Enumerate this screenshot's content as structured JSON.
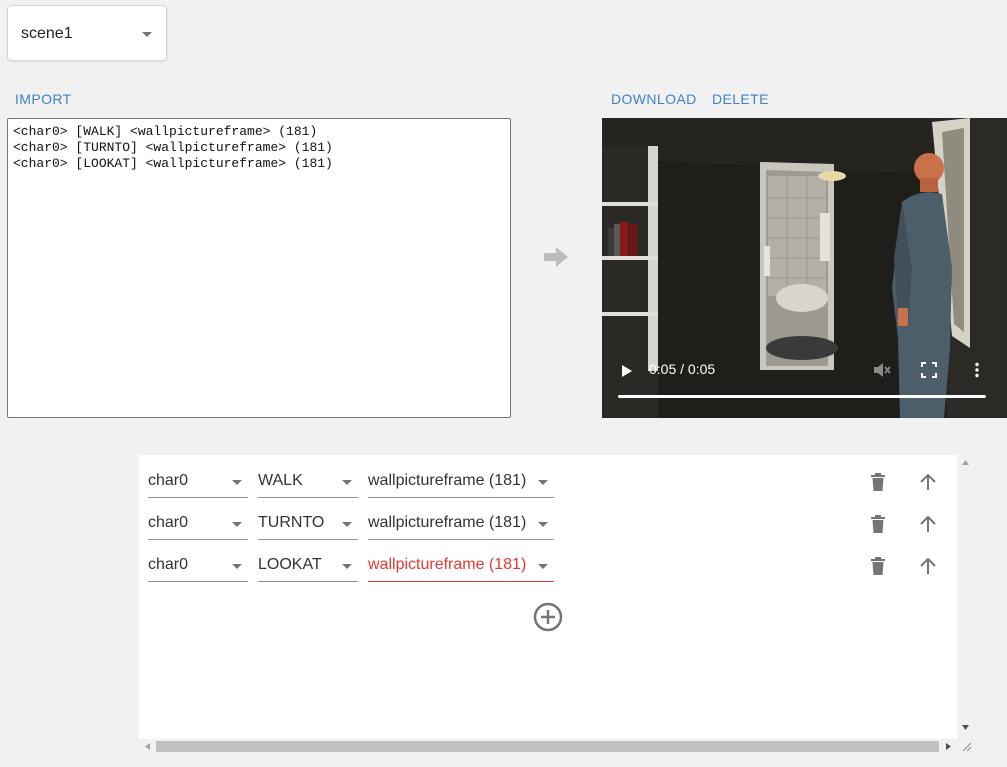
{
  "scene_selector": {
    "value": "scene1"
  },
  "toolbar_left": {
    "import_label": "IMPORT"
  },
  "toolbar_right": {
    "download_label": "DOWNLOAD",
    "delete_label": "DELETE"
  },
  "script_text": "<char0> [WALK] <wallpictureframe> (181)\n<char0> [TURNTO] <wallpictureframe> (181)\n<char0> [LOOKAT] <wallpictureframe> (181)",
  "video": {
    "time": "0:05 / 0:05",
    "progress": 1.0
  },
  "program": {
    "rows": [
      {
        "character": "char0",
        "action": "WALK",
        "object": "wallpictureframe (181)",
        "error": false
      },
      {
        "character": "char0",
        "action": "TURNTO",
        "object": "wallpictureframe (181)",
        "error": false
      },
      {
        "character": "char0",
        "action": "LOOKAT",
        "object": "wallpictureframe (181)",
        "error": true
      }
    ]
  },
  "colors": {
    "accent": "#3f82c8",
    "error": "#e53935",
    "icon": "#757575"
  },
  "icons": {
    "run": "arrow-right-icon",
    "delete_row": "trash-icon",
    "move_up": "arrow-up-icon",
    "add_row": "add-circle-icon"
  }
}
